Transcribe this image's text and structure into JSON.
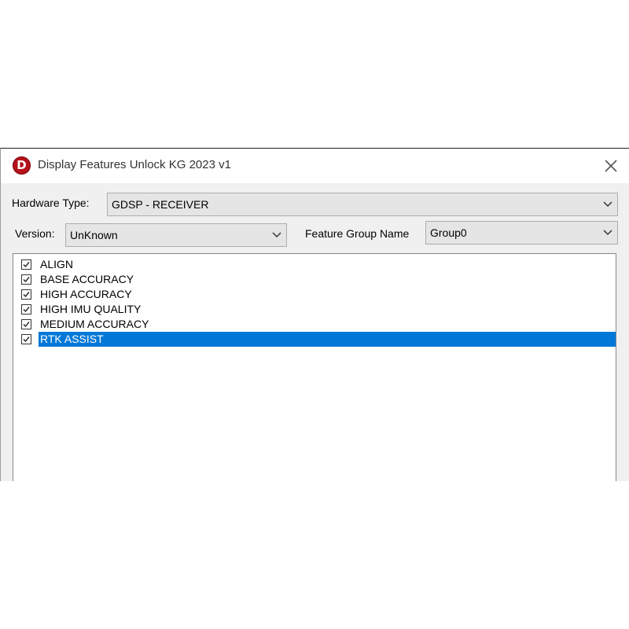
{
  "window": {
    "title": "Display Features Unlock KG 2023 v1",
    "icon_letter": "D",
    "accent_color": "#0078d7",
    "icon_color": "#b5121b"
  },
  "hardware": {
    "label": "Hardware Type:",
    "value": "GDSP - RECEIVER"
  },
  "version": {
    "label": "Version:",
    "value": "UnKnown"
  },
  "feature_group": {
    "label": "Feature Group Name",
    "value": "Group0"
  },
  "features": [
    {
      "label": "ALIGN",
      "checked": true,
      "selected": false
    },
    {
      "label": "BASE ACCURACY",
      "checked": true,
      "selected": false
    },
    {
      "label": "HIGH ACCURACY",
      "checked": true,
      "selected": false
    },
    {
      "label": "HIGH IMU QUALITY",
      "checked": true,
      "selected": false
    },
    {
      "label": "MEDIUM ACCURACY",
      "checked": true,
      "selected": false
    },
    {
      "label": "RTK ASSIST",
      "checked": true,
      "selected": true
    }
  ],
  "icons": {
    "close": "close-icon",
    "dropdown": "chevron-down-icon",
    "check": "checkmark-icon"
  }
}
